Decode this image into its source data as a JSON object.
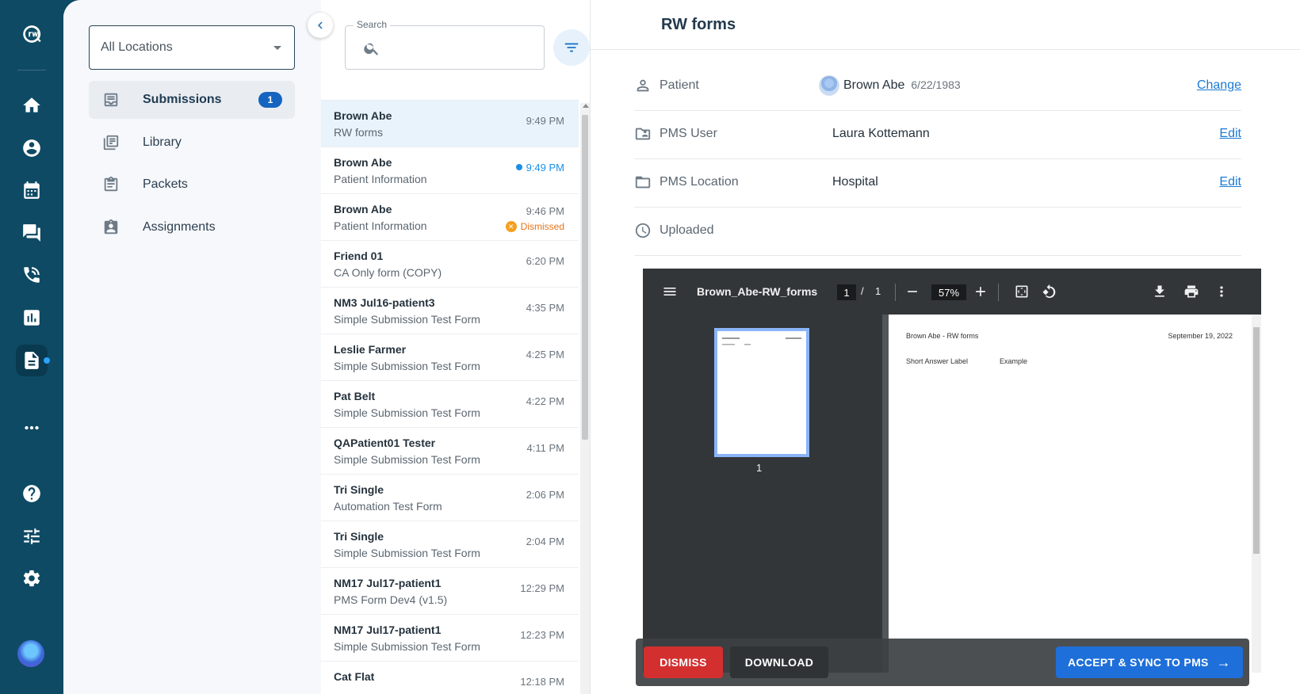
{
  "nav": {
    "location_select": "All Locations",
    "items": [
      {
        "label": "Submissions",
        "badge": "1"
      },
      {
        "label": "Library"
      },
      {
        "label": "Packets"
      },
      {
        "label": "Assignments"
      }
    ]
  },
  "search": {
    "label": "Search",
    "placeholder": ""
  },
  "submissions": [
    {
      "name": "Brown Abe",
      "form": "RW forms",
      "time": "9:49 PM"
    },
    {
      "name": "Brown Abe",
      "form": "Patient Information",
      "time": "9:49 PM"
    },
    {
      "name": "Brown Abe",
      "form": "Patient Information",
      "time": "9:46 PM",
      "status": "Dismissed"
    },
    {
      "name": "Friend 01",
      "form": "CA Only form (COPY)",
      "time": "6:20 PM"
    },
    {
      "name": "NM3 Jul16-patient3",
      "form": "Simple Submission Test Form",
      "time": "4:35 PM"
    },
    {
      "name": "Leslie Farmer",
      "form": "Simple Submission Test Form",
      "time": "4:25 PM"
    },
    {
      "name": "Pat Belt",
      "form": "Simple Submission Test Form",
      "time": "4:22 PM"
    },
    {
      "name": "QAPatient01 Tester",
      "form": "Simple Submission Test Form",
      "time": "4:11 PM"
    },
    {
      "name": "Tri Single",
      "form": "Automation Test Form",
      "time": "2:06 PM"
    },
    {
      "name": "Tri Single",
      "form": "Simple Submission Test Form",
      "time": "2:04 PM"
    },
    {
      "name": "NM17 Jul17-patient1",
      "form": "PMS Form Dev4 (v1.5)",
      "time": "12:29 PM"
    },
    {
      "name": "NM17 Jul17-patient1",
      "form": "Simple Submission Test Form",
      "time": "12:23 PM"
    },
    {
      "name": "Cat Flat",
      "form": "",
      "time": "12:18 PM"
    }
  ],
  "detail": {
    "title": "RW forms",
    "patient": {
      "label": "Patient",
      "name": "Brown Abe",
      "dob": "6/22/1983",
      "action": "Change"
    },
    "pms_user": {
      "label": "PMS User",
      "value": "Laura Kottemann",
      "action": "Edit"
    },
    "pms_location": {
      "label": "PMS Location",
      "value": "Hospital",
      "action": "Edit"
    },
    "uploaded": {
      "label": "Uploaded",
      "value": ""
    }
  },
  "pdf": {
    "filename": "Brown_Abe-RW_forms",
    "page": "1",
    "separator": "/",
    "total_pages": "1",
    "zoom": "57%",
    "thumb_label": "1",
    "doc_title": "Brown Abe - RW forms",
    "doc_date": "September 19, 2022",
    "field_label": "Short Answer Label",
    "field_value": "Example"
  },
  "actions": {
    "dismiss": "DISMISS",
    "download": "DOWNLOAD",
    "accept": "ACCEPT & SYNC TO PMS"
  },
  "colors": {
    "rail": "#0e4a64",
    "accent": "#1e6fd9",
    "danger": "#d32f2f"
  }
}
